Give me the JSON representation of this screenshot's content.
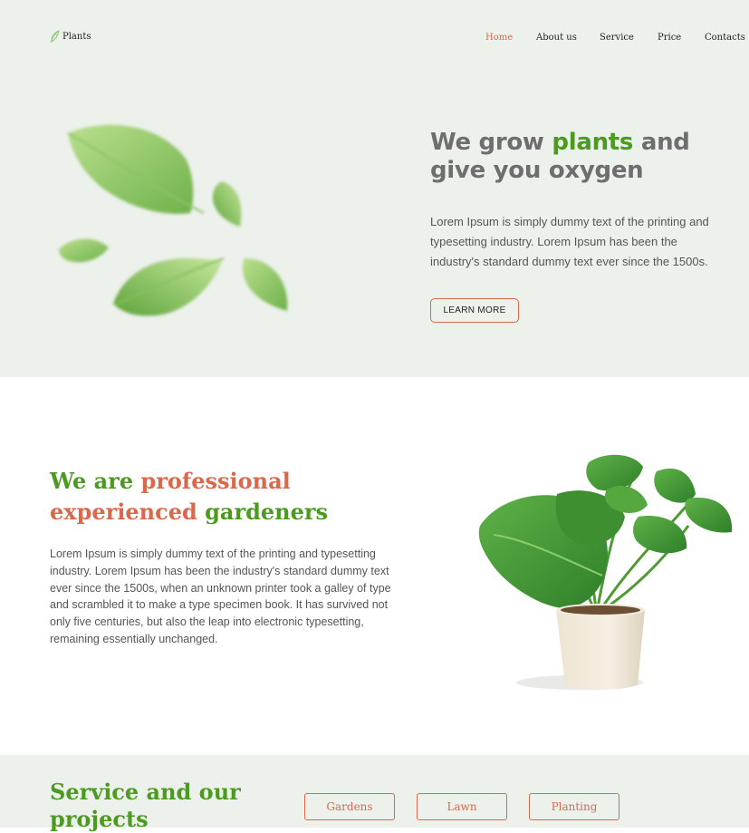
{
  "header": {
    "logo_text": "Plants",
    "nav": [
      {
        "label": "Home",
        "active": true
      },
      {
        "label": "About us",
        "active": false
      },
      {
        "label": "Service",
        "active": false
      },
      {
        "label": "Price",
        "active": false
      },
      {
        "label": "Contacts",
        "active": false
      }
    ]
  },
  "hero": {
    "title_part1": "We grow ",
    "title_accent": "plants",
    "title_part2": " and give you oxygen",
    "text": "Lorem Ipsum is simply dummy text of the printing and typesetting industry. Lorem Ipsum has been the industry's standard dummy text ever since the 1500s.",
    "button_label": "LEARN MORE",
    "image_icon": "blurred-leaves-image"
  },
  "about": {
    "title_part1": "We are ",
    "title_accent": "professional experienced",
    "title_part2": " gardeners",
    "text": "Lorem Ipsum is simply dummy text of the printing and typesetting industry. Lorem Ipsum has been the industry's standard dummy text ever since the 1500s, when an unknown printer took a galley of type and scrambled it to make a type specimen book. It has survived not only five centuries, but also the leap into electronic typesetting, remaining essentially unchanged.",
    "image_icon": "potted-monstera-image"
  },
  "services": {
    "title": "Service and our projects",
    "tabs": [
      "Gardens",
      "Lawn",
      "Planting"
    ]
  },
  "colors": {
    "accent_green": "#4c9a1f",
    "accent_orange": "#d9694a",
    "section_bg": "#edf1ec"
  }
}
